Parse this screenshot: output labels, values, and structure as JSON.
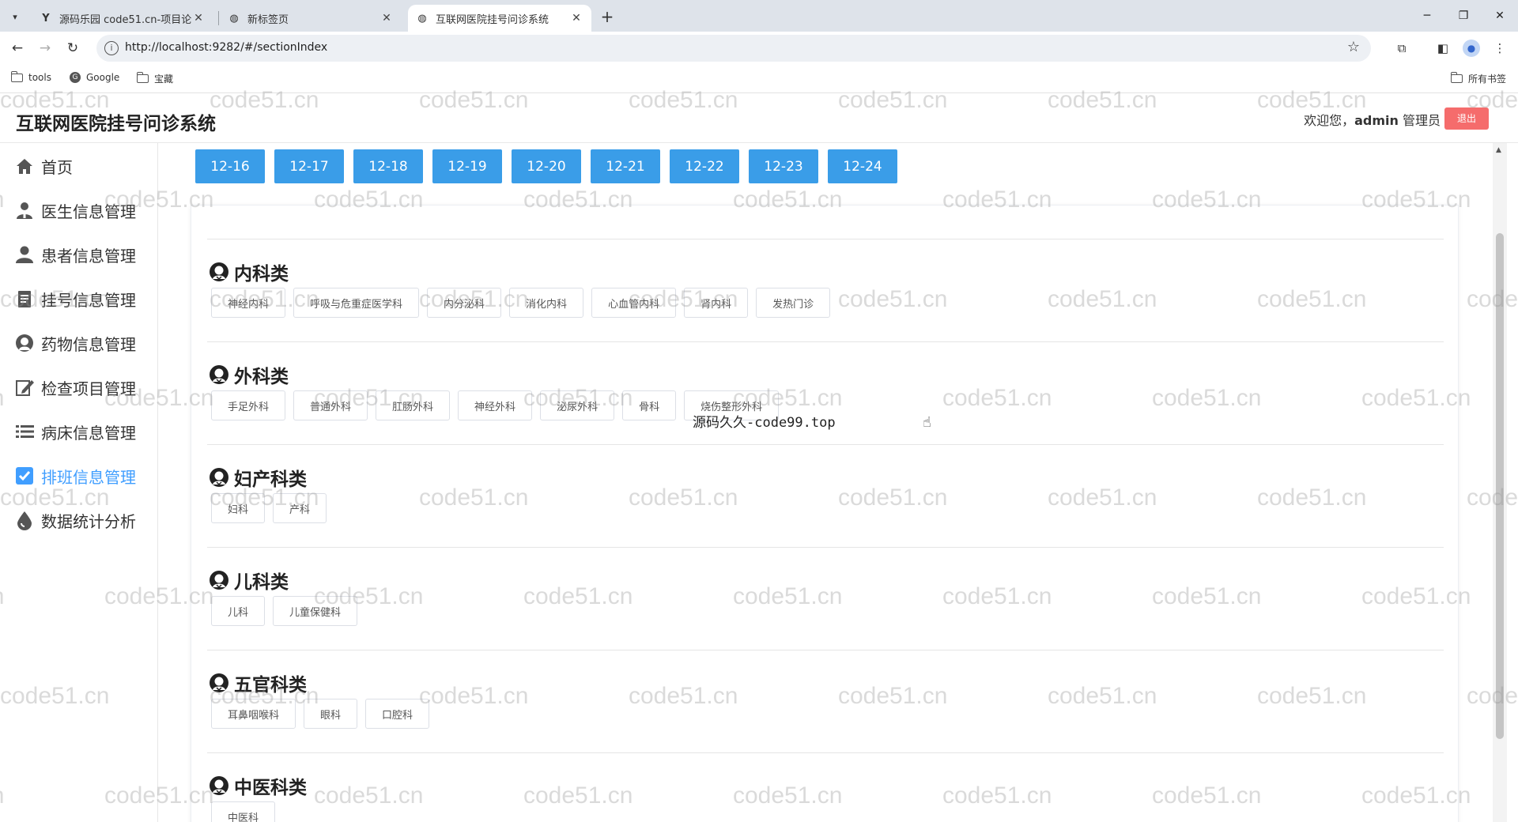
{
  "browser": {
    "tabs": [
      {
        "title": "源码乐园 code51.cn-项目论文",
        "favicon": "Y"
      },
      {
        "title": "新标签页",
        "favicon": "globe-icon"
      },
      {
        "title": "互联网医院挂号问诊系统",
        "favicon": "globe-icon"
      }
    ],
    "url": "http://localhost:9282/#/sectionIndex",
    "bookmarks": [
      "tools",
      "Google",
      "宝藏"
    ],
    "all_bookmarks": "所有书签"
  },
  "app": {
    "title": "互联网医院挂号问诊系统",
    "welcome_prefix": "欢迎您，",
    "user": "admin",
    "role": "管理员",
    "logout": "退出"
  },
  "sidebar": {
    "items": [
      {
        "label": "首页",
        "icon": "home-icon"
      },
      {
        "label": "医生信息管理",
        "icon": "doctor-icon"
      },
      {
        "label": "患者信息管理",
        "icon": "patient-icon"
      },
      {
        "label": "挂号信息管理",
        "icon": "document-icon"
      },
      {
        "label": "药物信息管理",
        "icon": "medicine-icon"
      },
      {
        "label": "检查项目管理",
        "icon": "edit-icon"
      },
      {
        "label": "病床信息管理",
        "icon": "list-icon"
      },
      {
        "label": "排班信息管理",
        "icon": "checkbox-icon",
        "active": true
      },
      {
        "label": "数据统计分析",
        "icon": "drop-icon"
      }
    ]
  },
  "dates": [
    "12-16",
    "12-17",
    "12-18",
    "12-19",
    "12-20",
    "12-21",
    "12-22",
    "12-23",
    "12-24"
  ],
  "categories": [
    {
      "name": "内科类",
      "depts": [
        "神经内科",
        "呼吸与危重症医学科",
        "内分泌科",
        "消化内科",
        "心血管内科",
        "肾内科",
        "发热门诊"
      ]
    },
    {
      "name": "外科类",
      "depts": [
        "手足外科",
        "普通外科",
        "肛肠外科",
        "神经外科",
        "泌尿外科",
        "骨科",
        "烧伤整形外科"
      ]
    },
    {
      "name": "妇产科类",
      "depts": [
        "妇科",
        "产科"
      ]
    },
    {
      "name": "儿科类",
      "depts": [
        "儿科",
        "儿童保健科"
      ]
    },
    {
      "name": "五官科类",
      "depts": [
        "耳鼻咽喉科",
        "眼科",
        "口腔科"
      ]
    },
    {
      "name": "中医科类",
      "depts": [
        "中医科"
      ]
    }
  ],
  "overlay_text": "源码久久-code99.top",
  "watermark": "code51.cn",
  "colors": {
    "accent": "#409eff",
    "date_button": "#3a9de8",
    "logout": "#f56c6c"
  }
}
